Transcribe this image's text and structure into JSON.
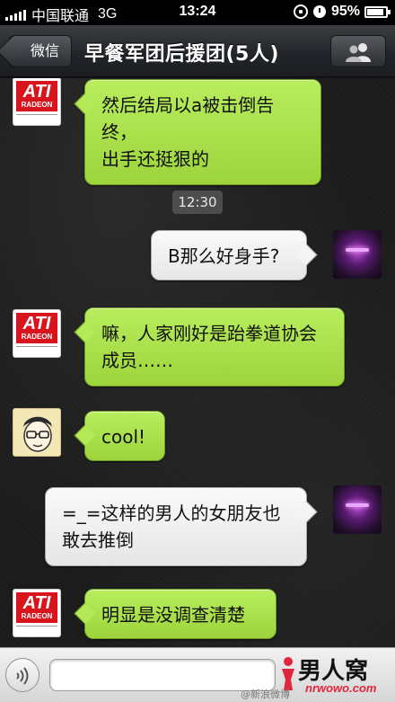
{
  "status_bar": {
    "carrier": "中国联通",
    "network": "3G",
    "time": "13:24",
    "battery": "95%"
  },
  "nav": {
    "back_label": "微信",
    "title": "早餐军团后援团(5人)",
    "members_icon": "people-icon"
  },
  "messages": [
    {
      "side": "left",
      "avatar": "ati-radeon-avatar",
      "text_lines": [
        "然后结局以a被击倒告终，",
        "出手还挺狠的"
      ]
    },
    {
      "side": "right",
      "avatar": "purple-character-avatar",
      "text_lines": [
        "B那么好身手?"
      ]
    },
    {
      "side": "left",
      "avatar": "ati-radeon-avatar",
      "text_lines": [
        "嘛，人家刚好是跆拳道协会",
        "成员……"
      ]
    },
    {
      "side": "left",
      "avatar": "cartoon-glasses-avatar",
      "text_lines": [
        "cool!"
      ]
    },
    {
      "side": "right",
      "avatar": "purple-character-avatar",
      "text_lines": [
        "=_=这样的男人的女朋友也",
        "敢去推倒"
      ]
    },
    {
      "side": "left",
      "avatar": "ati-radeon-avatar",
      "text_lines": [
        "明显是没调查清楚"
      ]
    }
  ],
  "timestamp": "12:30",
  "avatar_text": {
    "ati_logo": "ATI",
    "ati_sub": "RADEON"
  },
  "input_bar": {
    "voice_icon": "voice-icon",
    "input_value": ""
  },
  "watermark": {
    "title": "男人窝",
    "url": "nrwowo.com",
    "weibo": "@新浪微博"
  },
  "colors": {
    "green_bubble": "#a6dc45",
    "white_bubble": "#f0f0f0",
    "ati_red": "#d8141c"
  }
}
